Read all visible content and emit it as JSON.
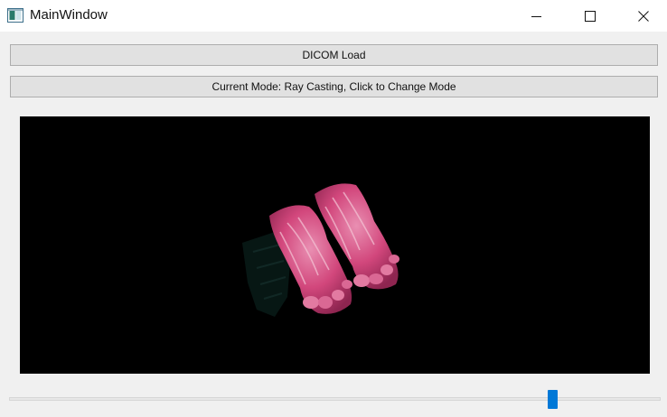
{
  "window": {
    "title": "MainWindow",
    "icon": "app-window-icon",
    "controls": [
      "minimize-icon",
      "maximize-icon",
      "close-icon"
    ]
  },
  "toolbar": {
    "load_label": "DICOM Load",
    "mode_label": "Current Mode: Ray Casting, Click to Change Mode"
  },
  "viewer": {
    "content": "volume-rendered feet",
    "background": "#000000",
    "tissue_color": "#d2477c"
  },
  "slider": {
    "value_fraction": 0.84,
    "handle_color": "#0078d7"
  }
}
